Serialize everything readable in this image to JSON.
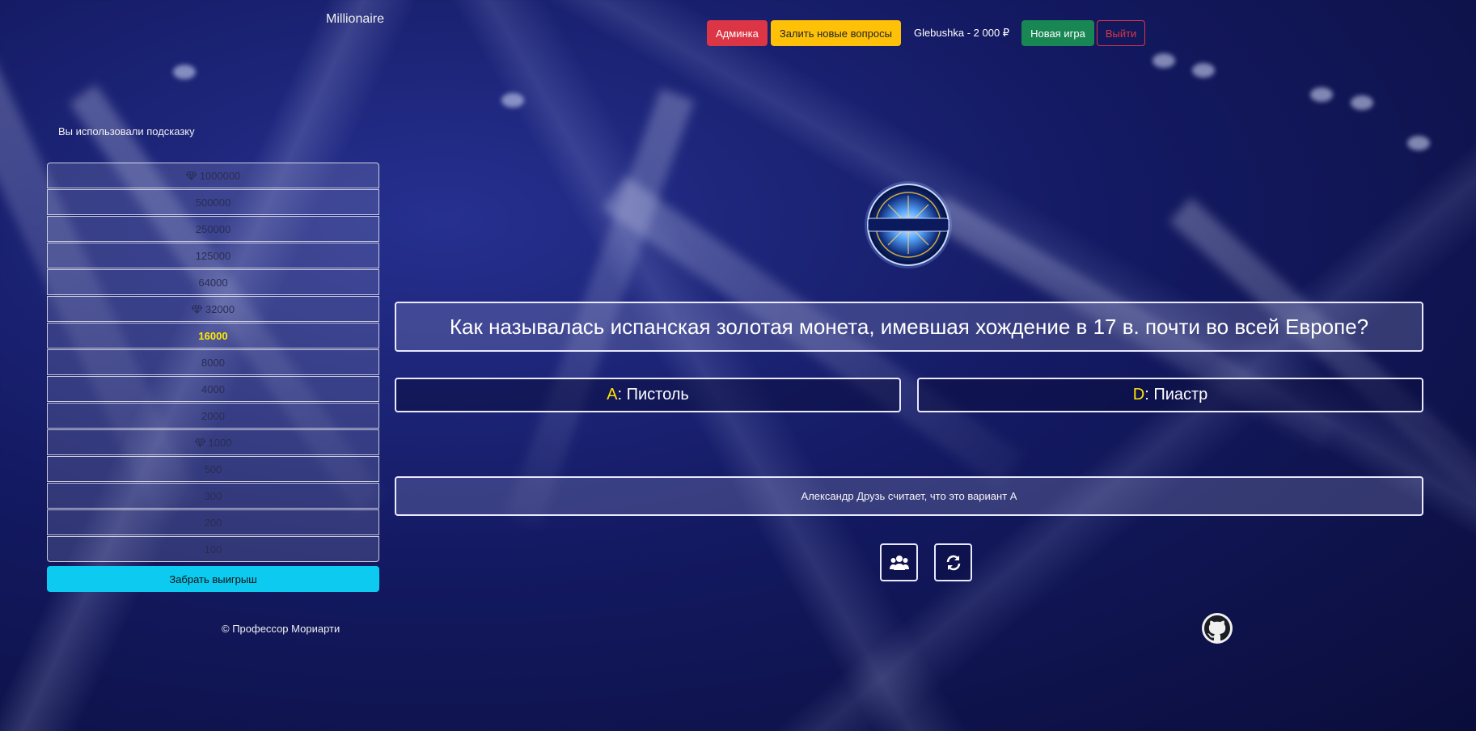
{
  "header": {
    "brand": "Millionaire",
    "admin_label": "Админка",
    "upload_label": "Залить новые вопросы",
    "user_info": "Glebushka - 2 000 ₽",
    "new_game_label": "Новая игра",
    "exit_label": "Выйти"
  },
  "sidebar": {
    "hint_used_text": "Вы использовали подсказку",
    "ladder": [
      {
        "amount": "1000000",
        "milestone": true,
        "active": false
      },
      {
        "amount": "500000",
        "milestone": false,
        "active": false
      },
      {
        "amount": "250000",
        "milestone": false,
        "active": false
      },
      {
        "amount": "125000",
        "milestone": false,
        "active": false
      },
      {
        "amount": "64000",
        "milestone": false,
        "active": false
      },
      {
        "amount": "32000",
        "milestone": true,
        "active": false
      },
      {
        "amount": "16000",
        "milestone": false,
        "active": true
      },
      {
        "amount": "8000",
        "milestone": false,
        "active": false
      },
      {
        "amount": "4000",
        "milestone": false,
        "active": false
      },
      {
        "amount": "2000",
        "milestone": false,
        "active": false
      },
      {
        "amount": "1000",
        "milestone": true,
        "active": false
      },
      {
        "amount": "500",
        "milestone": false,
        "active": false
      },
      {
        "amount": "300",
        "milestone": false,
        "active": false
      },
      {
        "amount": "200",
        "milestone": false,
        "active": false
      },
      {
        "amount": "100",
        "milestone": false,
        "active": false
      }
    ],
    "take_money_label": "Забрать выигрыш",
    "copyright": "© Профессор Мориарти"
  },
  "game": {
    "logo_icon": "millionaire-logo",
    "question": "Как называлась испанская золотая монета, имевшая хождение в 17 в. почти во всей Европе?",
    "answers": [
      {
        "letter": "A",
        "text": "Пистоль"
      },
      {
        "letter": "D",
        "text": "Пиастр"
      }
    ],
    "friend_hint": "Александр Друзь считает, что это вариант А",
    "lifelines": [
      {
        "icon": "users-icon"
      },
      {
        "icon": "refresh-icon"
      }
    ],
    "github_icon": "github-icon"
  },
  "colors": {
    "answer_letter": "#ffe500",
    "active_rung": "#ffeb00",
    "take_money_bg": "#0dcaf0",
    "admin_bg": "#dc3545",
    "upload_bg": "#ffc107",
    "new_game_bg": "#198754"
  }
}
